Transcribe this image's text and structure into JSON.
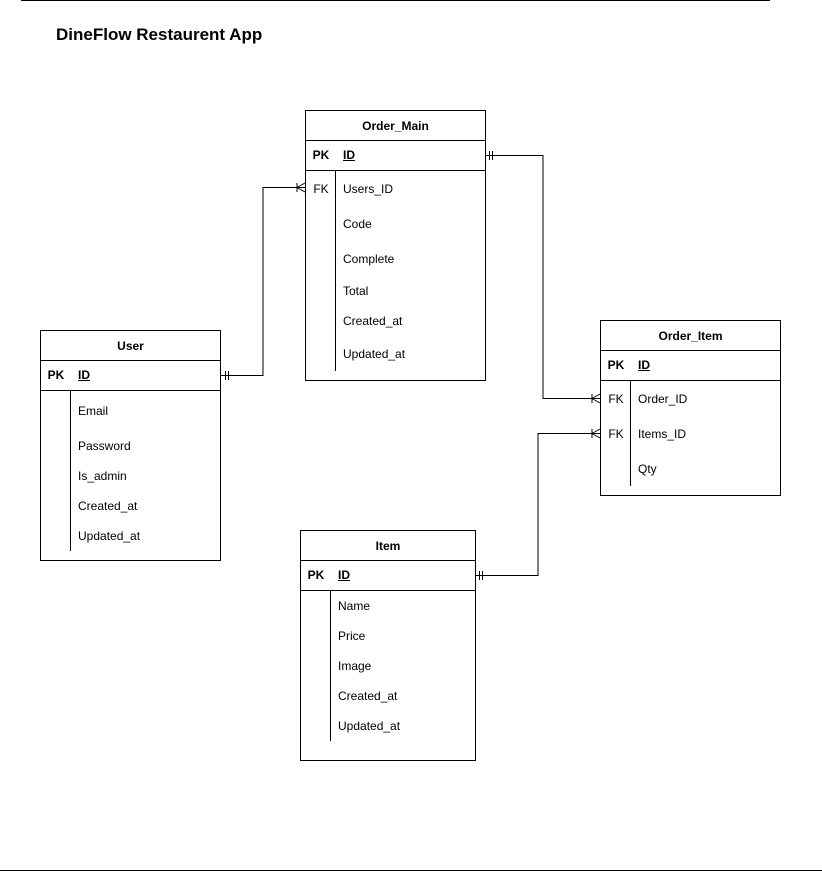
{
  "title": "DineFlow Restaurent App",
  "entities": {
    "order_main": {
      "name": "Order_Main",
      "pk": {
        "key": "PK",
        "name": "ID"
      },
      "fields": [
        {
          "key": "FK",
          "name": "Users_ID"
        },
        {
          "key": "",
          "name": "Code"
        },
        {
          "key": "",
          "name": "Complete"
        },
        {
          "key": "",
          "name": "Total"
        },
        {
          "key": "",
          "name": "Created_at"
        },
        {
          "key": "",
          "name": "Updated_at"
        }
      ]
    },
    "user": {
      "name": "User",
      "pk": {
        "key": "PK",
        "name": "ID"
      },
      "fields": [
        {
          "key": "",
          "name": "Email"
        },
        {
          "key": "",
          "name": "Password"
        },
        {
          "key": "",
          "name": "Is_admin"
        },
        {
          "key": "",
          "name": "Created_at"
        },
        {
          "key": "",
          "name": "Updated_at"
        }
      ]
    },
    "order_item": {
      "name": "Order_Item",
      "pk": {
        "key": "PK",
        "name": "ID"
      },
      "fields": [
        {
          "key": "FK",
          "name": "Order_ID"
        },
        {
          "key": "FK",
          "name": "Items_ID"
        },
        {
          "key": "",
          "name": "Qty"
        }
      ]
    },
    "item": {
      "name": "Item",
      "pk": {
        "key": "PK",
        "name": "ID"
      },
      "fields": [
        {
          "key": "",
          "name": "Name"
        },
        {
          "key": "",
          "name": "Price"
        },
        {
          "key": "",
          "name": "Image"
        },
        {
          "key": "",
          "name": "Created_at"
        },
        {
          "key": "",
          "name": "Updated_at"
        }
      ]
    }
  },
  "relationships": [
    {
      "from": "User.ID",
      "to": "Order_Main.Users_ID",
      "from_end": "one-and-only-one",
      "to_end": "one-or-many"
    },
    {
      "from": "Order_Main.ID",
      "to": "Order_Item.Order_ID",
      "from_end": "one-and-only-one",
      "to_end": "one-or-many"
    },
    {
      "from": "Item.ID",
      "to": "Order_Item.Items_ID",
      "from_end": "one-and-only-one",
      "to_end": "one-or-many"
    }
  ]
}
